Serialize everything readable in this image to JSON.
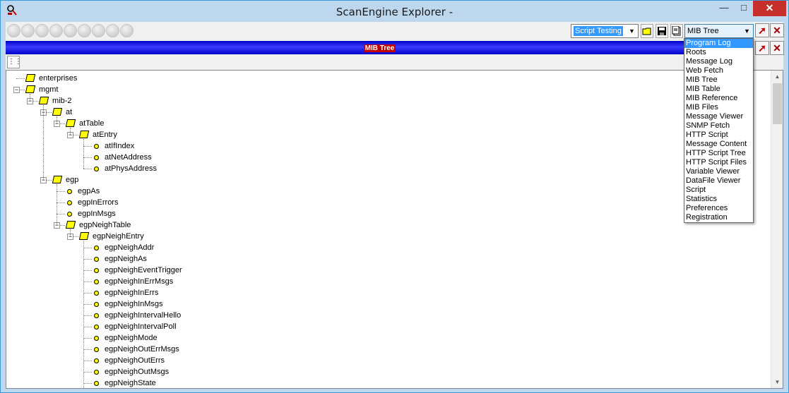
{
  "window": {
    "title": "ScanEngine Explorer -"
  },
  "toolbar": {
    "script_select_value": "Script Testing",
    "view_select_value": "MIB Tree"
  },
  "header_bar": {
    "label": "MIB Tree"
  },
  "dropdown": {
    "items": [
      "Program Log",
      "Roots",
      "Message Log",
      "Web Fetch",
      "MIB Tree",
      "MIB Table",
      "MIB Reference",
      "MIB Files",
      "Message Viewer",
      "SNMP Fetch",
      "HTTP Script",
      "Message Content",
      "HTTP Script Tree",
      "HTTP Script Files",
      "Variable Viewer",
      "DataFile Viewer",
      "Script",
      "Statistics",
      "Preferences",
      "Registration"
    ],
    "highlighted": "Program Log"
  },
  "tree": {
    "nodes": [
      {
        "label": "enterprises",
        "depth": 0,
        "kind": "folder",
        "expander": "none"
      },
      {
        "label": "mgmt",
        "depth": 0,
        "kind": "folder",
        "expander": "minus"
      },
      {
        "label": "mib-2",
        "depth": 1,
        "kind": "folder",
        "expander": "minus"
      },
      {
        "label": "at",
        "depth": 2,
        "kind": "folder",
        "expander": "minus"
      },
      {
        "label": "atTable",
        "depth": 3,
        "kind": "folder",
        "expander": "minus"
      },
      {
        "label": "atEntry",
        "depth": 4,
        "kind": "folder",
        "expander": "minus"
      },
      {
        "label": "atIfIndex",
        "depth": 5,
        "kind": "leaf",
        "expander": "none"
      },
      {
        "label": "atNetAddress",
        "depth": 5,
        "kind": "leaf",
        "expander": "none"
      },
      {
        "label": "atPhysAddress",
        "depth": 5,
        "kind": "leaf",
        "expander": "none"
      },
      {
        "label": "egp",
        "depth": 2,
        "kind": "folder",
        "expander": "minus"
      },
      {
        "label": "egpAs",
        "depth": 3,
        "kind": "leaf",
        "expander": "none"
      },
      {
        "label": "egpInErrors",
        "depth": 3,
        "kind": "leaf",
        "expander": "none"
      },
      {
        "label": "egpInMsgs",
        "depth": 3,
        "kind": "leaf",
        "expander": "none"
      },
      {
        "label": "egpNeighTable",
        "depth": 3,
        "kind": "folder",
        "expander": "minus"
      },
      {
        "label": "egpNeighEntry",
        "depth": 4,
        "kind": "folder",
        "expander": "minus"
      },
      {
        "label": "egpNeighAddr",
        "depth": 5,
        "kind": "leaf",
        "expander": "none"
      },
      {
        "label": "egpNeighAs",
        "depth": 5,
        "kind": "leaf",
        "expander": "none"
      },
      {
        "label": "egpNeighEventTrigger",
        "depth": 5,
        "kind": "leaf",
        "expander": "none"
      },
      {
        "label": "egpNeighInErrMsgs",
        "depth": 5,
        "kind": "leaf",
        "expander": "none"
      },
      {
        "label": "egpNeighInErrs",
        "depth": 5,
        "kind": "leaf",
        "expander": "none"
      },
      {
        "label": "egpNeighInMsgs",
        "depth": 5,
        "kind": "leaf",
        "expander": "none"
      },
      {
        "label": "egpNeighIntervalHello",
        "depth": 5,
        "kind": "leaf",
        "expander": "none"
      },
      {
        "label": "egpNeighIntervalPoll",
        "depth": 5,
        "kind": "leaf",
        "expander": "none"
      },
      {
        "label": "egpNeighMode",
        "depth": 5,
        "kind": "leaf",
        "expander": "none"
      },
      {
        "label": "egpNeighOutErrMsgs",
        "depth": 5,
        "kind": "leaf",
        "expander": "none"
      },
      {
        "label": "egpNeighOutErrs",
        "depth": 5,
        "kind": "leaf",
        "expander": "none"
      },
      {
        "label": "egpNeighOutMsgs",
        "depth": 5,
        "kind": "leaf",
        "expander": "none"
      },
      {
        "label": "egpNeighState",
        "depth": 5,
        "kind": "leaf",
        "expander": "none"
      }
    ]
  },
  "icons": {
    "app": "scanner-icon",
    "minimize": "minimize-icon",
    "maximize": "maximize-icon",
    "close": "close-icon"
  },
  "colors": {
    "header_bar": "#0000c8",
    "header_label_bg": "#c00000",
    "selection": "#3399ff",
    "folder": "#ffff00"
  }
}
